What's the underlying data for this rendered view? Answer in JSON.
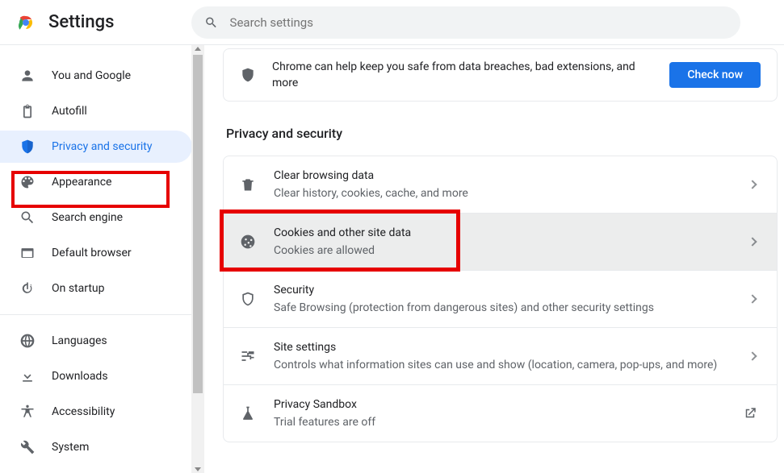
{
  "header": {
    "title": "Settings",
    "search_placeholder": "Search settings"
  },
  "sidebar": {
    "items_top": [
      {
        "label": "You and Google",
        "icon": "person"
      },
      {
        "label": "Autofill",
        "icon": "autofill"
      },
      {
        "label": "Privacy and security",
        "icon": "shield",
        "selected": true
      },
      {
        "label": "Appearance",
        "icon": "palette"
      },
      {
        "label": "Search engine",
        "icon": "search"
      },
      {
        "label": "Default browser",
        "icon": "browser"
      },
      {
        "label": "On startup",
        "icon": "power"
      }
    ],
    "items_bottom": [
      {
        "label": "Languages",
        "icon": "globe"
      },
      {
        "label": "Downloads",
        "icon": "download"
      },
      {
        "label": "Accessibility",
        "icon": "accessibility"
      },
      {
        "label": "System",
        "icon": "wrench"
      }
    ]
  },
  "banner": {
    "text": "Chrome can help keep you safe from data breaches, bad extensions, and more",
    "button": "Check now"
  },
  "section": {
    "title": "Privacy and security"
  },
  "rows": {
    "clear": {
      "title": "Clear browsing data",
      "sub": "Clear history, cookies, cache, and more"
    },
    "cookies": {
      "title": "Cookies and other site data",
      "sub": "Cookies are allowed"
    },
    "security": {
      "title": "Security",
      "sub": "Safe Browsing (protection from dangerous sites) and other security settings"
    },
    "site": {
      "title": "Site settings",
      "sub": "Controls what information sites can use and show (location, camera, pop-ups, and more)"
    },
    "sandbox": {
      "title": "Privacy Sandbox",
      "sub": "Trial features are off"
    }
  },
  "colors": {
    "accent": "#1a73e8",
    "highlight": "#e60000"
  }
}
